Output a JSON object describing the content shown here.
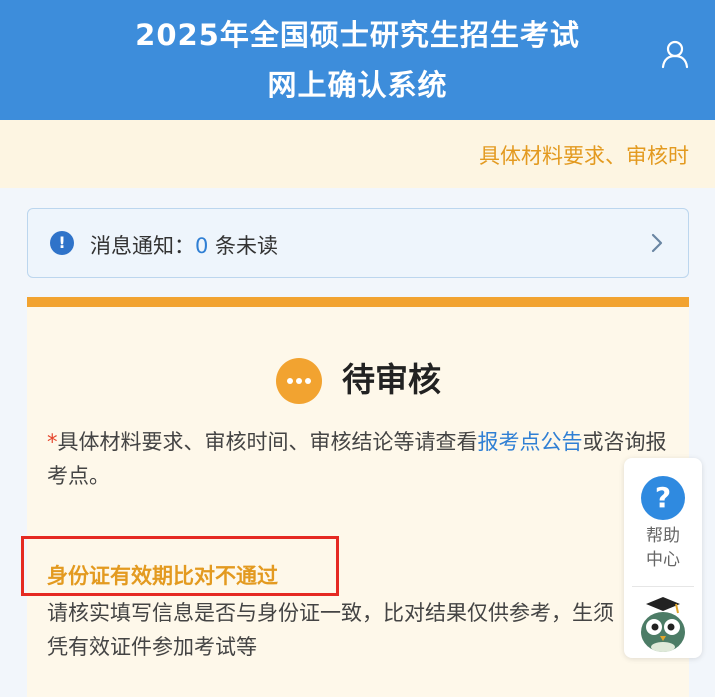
{
  "header": {
    "title_line1": "2025年全国硕士研究生招生考试",
    "title_line2": "网上确认系统",
    "user_icon": "user-icon"
  },
  "notice_strip": {
    "text": "具体材料要求、审核时"
  },
  "message": {
    "label": "消息通知：",
    "count": "0",
    "suffix": " 条未读",
    "icon": "info-icon",
    "arrow_icon": "chevron-right-icon"
  },
  "status": {
    "icon": "more-dots-icon",
    "title": "待审核",
    "star": "*",
    "desc_before": "具体材料要求、审核时间、审核结论等请查看",
    "desc_link": "报考点公告",
    "desc_after": "或咨询报考点。"
  },
  "verification": {
    "title": "身份证有效期比对不通过",
    "desc": "请核实填写信息是否与身份证一致，比对结果仅供参考，生须凭有效证件参加考试等"
  },
  "help": {
    "icon": "question-icon",
    "label_line1": "帮助",
    "label_line2": "中心",
    "assistant_icon": "owl-assistant-icon"
  },
  "colors": {
    "header_bg": "#3d8ddb",
    "accent_orange": "#f2a330",
    "link_blue": "#2f7fd4",
    "alert_red": "#e52a22"
  }
}
